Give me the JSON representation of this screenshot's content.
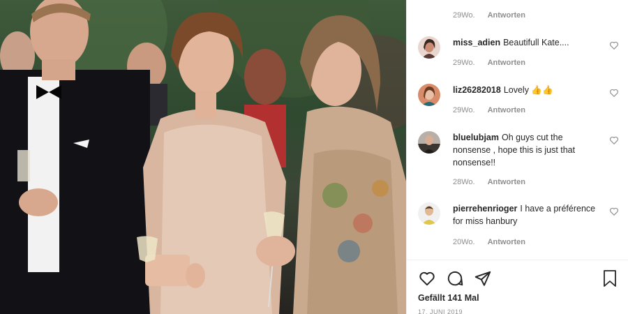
{
  "photo": {
    "alt": ""
  },
  "top_meta": {
    "age": "29Wo.",
    "reply": "Antworten"
  },
  "comments": [
    {
      "user": "miss_adien",
      "text": "Beautifull Kate....",
      "age": "29Wo.",
      "reply": "Antworten"
    },
    {
      "user": "liz26282018",
      "text": "Lovely 👍👍",
      "age": "29Wo.",
      "reply": "Antworten"
    },
    {
      "user": "bluelubjam",
      "text": "Oh guys cut the nonsense , hope this is just that nonsense!!",
      "age": "28Wo.",
      "reply": "Antworten"
    },
    {
      "user": "pierrehenrioger",
      "text": "I have a préférence for miss hanbury",
      "age": "20Wo.",
      "reply": "Antworten"
    }
  ],
  "likes": "Gefällt 141 Mal",
  "date": "17. JUNI 2019",
  "icons": {
    "like": "heart-icon",
    "comment": "comment-icon",
    "share": "share-icon",
    "save": "bookmark-icon"
  }
}
